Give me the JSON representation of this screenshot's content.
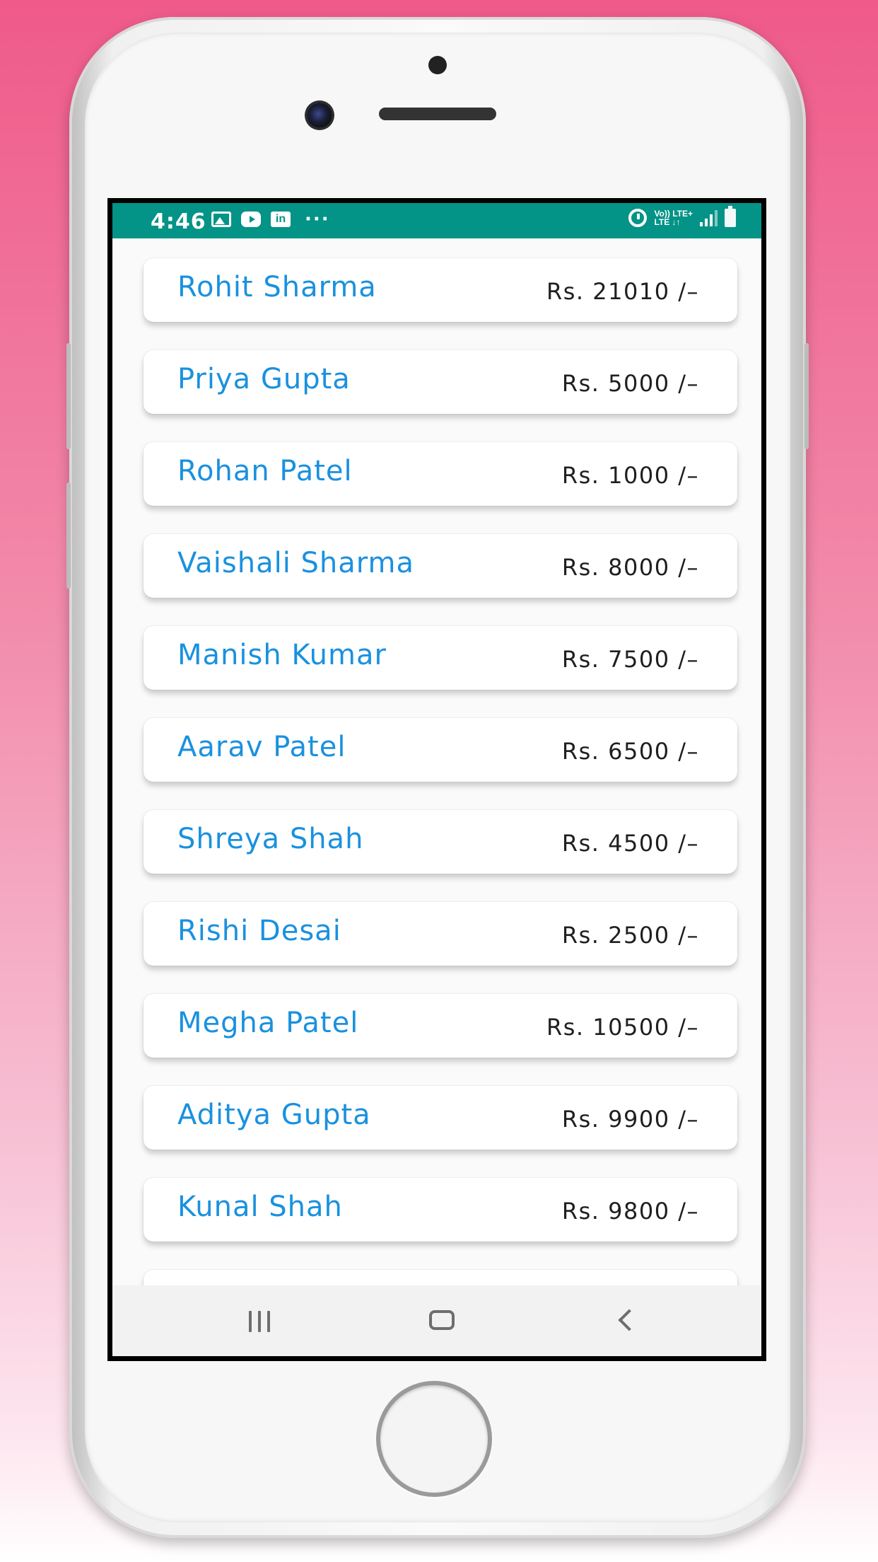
{
  "status_bar": {
    "time": "4:46",
    "left_icons": [
      "gallery-icon",
      "youtube-icon",
      "linkedin-icon",
      "more-notifications-icon"
    ],
    "linkedin_glyph": "in",
    "more_glyph": "···",
    "network_line1": "Vo)) LTE+",
    "network_line2": "LTE ↓↑",
    "right_icons": [
      "alarm-icon",
      "volte-icon",
      "signal-icon",
      "battery-icon"
    ],
    "background_color": "#039387"
  },
  "list": {
    "name_color": "#1a91df",
    "amount_color": "#1f1f1f",
    "items": [
      {
        "name": "Rohit Sharma",
        "amount": "Rs. 21010 /–"
      },
      {
        "name": "Priya Gupta",
        "amount": "Rs. 5000 /–"
      },
      {
        "name": "Rohan Patel",
        "amount": "Rs. 1000 /–"
      },
      {
        "name": "Vaishali Sharma",
        "amount": "Rs. 8000 /–"
      },
      {
        "name": "Manish Kumar",
        "amount": "Rs. 7500 /–"
      },
      {
        "name": "Aarav Patel",
        "amount": "Rs. 6500 /–"
      },
      {
        "name": "Shreya Shah",
        "amount": "Rs. 4500 /–"
      },
      {
        "name": "Rishi Desai",
        "amount": "Rs. 2500 /–"
      },
      {
        "name": "Megha Patel",
        "amount": "Rs. 10500 /–"
      },
      {
        "name": "Aditya Gupta",
        "amount": "Rs. 9900 /–"
      },
      {
        "name": "Kunal Shah",
        "amount": "Rs. 9800 /–"
      }
    ]
  },
  "nav_bar": {
    "buttons": [
      "recents-icon",
      "home-icon",
      "back-icon"
    ]
  },
  "background_gradient": [
    "#ef5a8a",
    "#ffffff"
  ]
}
